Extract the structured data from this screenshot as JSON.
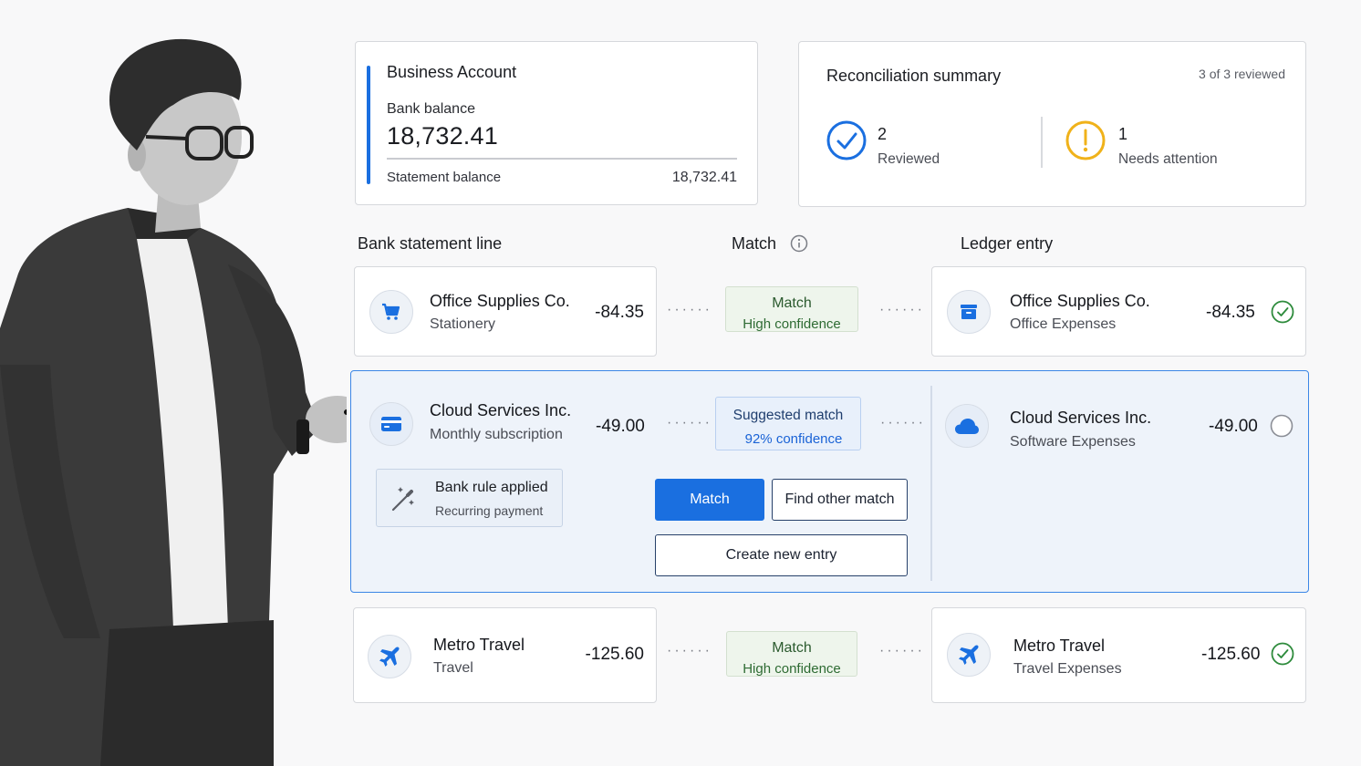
{
  "account": {
    "title": "Business Account",
    "bank_balance_label": "Bank balance",
    "bank_balance": "18,732.41",
    "statement_label": "Statement balance",
    "statement_balance": "18,732.41"
  },
  "summary": {
    "title": "Reconciliation summary",
    "progress": "3 of 3 reviewed",
    "reviewed_count": "2",
    "reviewed_label": "Reviewed",
    "attention_count": "1",
    "attention_label": "Needs attention"
  },
  "columns": {
    "bank": "Bank statement line",
    "match": "Match",
    "ledger": "Ledger entry"
  },
  "rows": [
    {
      "bank_name": "Office Supplies Co.",
      "bank_sub": "Stationery",
      "bank_amount": "-84.35",
      "bank_icon": "cart-icon",
      "match_title": "Match",
      "match_conf": "High confidence",
      "ledger_name": "Office Supplies Co.",
      "ledger_sub": "Office Expenses",
      "ledger_amount": "-84.35",
      "ledger_icon": "archive-box-icon",
      "status": "matched"
    },
    {
      "bank_name": "Cloud Services Inc.",
      "bank_sub": "Monthly subscription",
      "bank_amount": "-49.00",
      "bank_icon": "credit-card-icon",
      "match_title": "Suggested match",
      "match_conf": "92% confidence",
      "ledger_name": "Cloud Services Inc.",
      "ledger_sub": "Software Expenses",
      "ledger_amount": "-49.00",
      "ledger_icon": "cloud-icon",
      "status": "pending",
      "rule_title": "Bank rule applied",
      "rule_sub": "Recurring payment",
      "btn_match": "Match",
      "btn_find": "Find other match",
      "btn_create": "Create new entry"
    },
    {
      "bank_name": "Metro Travel",
      "bank_sub": "Travel",
      "bank_amount": "-125.60",
      "bank_icon": "airplane-icon",
      "match_title": "Match",
      "match_conf": "High confidence",
      "ledger_name": "Metro Travel",
      "ledger_sub": "Travel Expenses",
      "ledger_amount": "-125.60",
      "ledger_icon": "airplane-icon",
      "status": "matched"
    }
  ],
  "colors": {
    "accent": "#1a6fe0",
    "success": "#2e8b3c",
    "warning": "#f0b21a",
    "highlight_bg": "#eef3fa"
  }
}
